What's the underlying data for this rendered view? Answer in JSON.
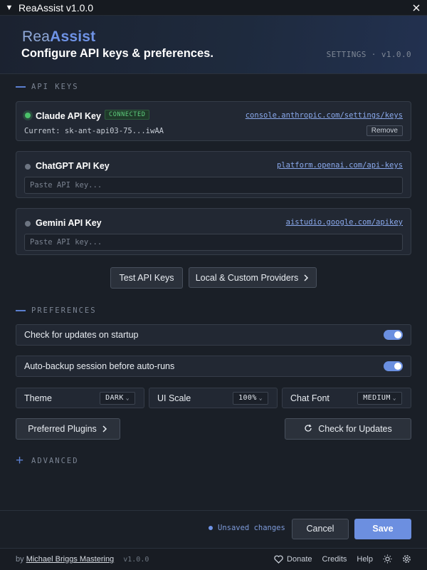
{
  "window": {
    "title": "ReaAssist v1.0.0"
  },
  "header": {
    "brand_part1": "Rea",
    "brand_part2": "Assist",
    "subtitle": "Configure API keys & preferences.",
    "settings_version": "SETTINGS · v1.0.0"
  },
  "sections": {
    "api_keys": "API KEYS",
    "preferences": "PREFERENCES",
    "advanced": "ADVANCED"
  },
  "api_keys": [
    {
      "name": "Claude API Key",
      "status": "CONNECTED",
      "link": "console.anthropic.com/settings/keys",
      "current": "Current: sk-ant-api03-75...iwAA",
      "remove_label": "Remove"
    },
    {
      "name": "ChatGPT API Key",
      "link": "platform.openai.com/api-keys",
      "placeholder": "Paste API key..."
    },
    {
      "name": "Gemini API Key",
      "link": "aistudio.google.com/apikey",
      "placeholder": "Paste API key..."
    }
  ],
  "buttons": {
    "test_keys": "Test API Keys",
    "providers": "Local & Custom Providers",
    "preferred_plugins": "Preferred Plugins",
    "check_updates": "Check for Updates",
    "cancel": "Cancel",
    "save": "Save"
  },
  "preferences": {
    "check_updates_startup": {
      "label": "Check for updates on startup",
      "enabled": true
    },
    "auto_backup": {
      "label": "Auto-backup session before auto-runs",
      "enabled": true
    },
    "theme": {
      "label": "Theme",
      "value": "DARK"
    },
    "ui_scale": {
      "label": "UI Scale",
      "value": "100%"
    },
    "chat_font": {
      "label": "Chat Font",
      "value": "MEDIUM"
    }
  },
  "footer": {
    "unsaved": "Unsaved changes",
    "by": "by",
    "author": "Michael Briggs Mastering",
    "version": "v1.0.0",
    "donate": "Donate",
    "credits": "Credits",
    "help": "Help"
  },
  "icons": {
    "collapse": "triangle-down-icon",
    "close": "close-icon",
    "chevron": "chevron-right-icon",
    "refresh": "refresh-icon",
    "heart": "heart-icon",
    "sun": "sun-icon",
    "gear": "gear-icon"
  },
  "colors": {
    "accent": "#6c8fe0",
    "connected": "#4bc26a",
    "background": "#1a1f27"
  }
}
